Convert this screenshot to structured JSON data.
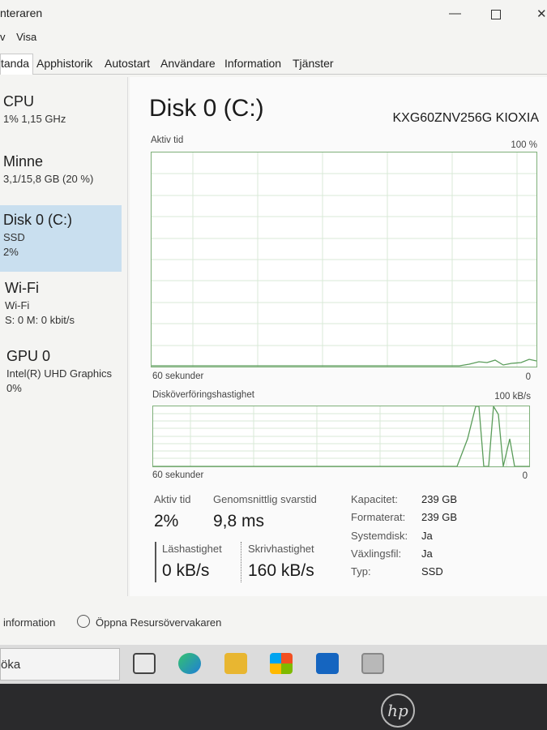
{
  "window": {
    "title": "nteraren",
    "close_glyph": "✕"
  },
  "menu": [
    "v",
    "Visa"
  ],
  "tabs": [
    {
      "label": "tanda",
      "active": true
    },
    {
      "label": "Apphistorik"
    },
    {
      "label": "Autostart"
    },
    {
      "label": "Användare"
    },
    {
      "label": "Information"
    },
    {
      "label": "Tjänster"
    }
  ],
  "sidebar": [
    {
      "name": "CPU",
      "line1": "1%  1,15 GHz",
      "line2": ""
    },
    {
      "name": "Minne",
      "line1": "3,1/15,8 GB (20 %)",
      "line2": ""
    },
    {
      "name": "Disk 0 (C:)",
      "line1": "SSD",
      "line2": "2%",
      "selected": true
    },
    {
      "name": "Wi-Fi",
      "line1": "Wi-Fi",
      "line2": "S: 0  M: 0 kbit/s"
    },
    {
      "name": "GPU 0",
      "line1": "Intel(R) UHD Graphics",
      "line2": "0%"
    }
  ],
  "main": {
    "title": "Disk 0 (C:)",
    "model": "KXG60ZNV256G KIOXIA",
    "graph1": {
      "label": "Aktiv tid",
      "max": "100 %",
      "time": "60 sekunder",
      "min": "0"
    },
    "graph2": {
      "label": "Disköverföringshastighet",
      "max": "100 kB/s",
      "time": "60 sekunder",
      "min": "0"
    },
    "stats": {
      "active_label": "Aktiv tid",
      "active_value": "2%",
      "resp_label": "Genomsnittlig svarstid",
      "resp_value": "9,8 ms",
      "read_label": "Läshastighet",
      "read_value": "0 kB/s",
      "write_label": "Skrivhastighet",
      "write_value": "160 kB/s"
    },
    "props": [
      {
        "key": "Kapacitet:",
        "value": "239 GB"
      },
      {
        "key": "Formaterat:",
        "value": "239 GB"
      },
      {
        "key": "Systemdisk:",
        "value": "Ja"
      },
      {
        "key": "Växlingsfil:",
        "value": "Ja"
      },
      {
        "key": "Typ:",
        "value": "SSD"
      }
    ]
  },
  "footer": {
    "less_info": "information",
    "open_monitor": "Öppna Resursövervakaren"
  },
  "taskbar": {
    "search": "öka"
  },
  "colors": {
    "graph_line": "#6aa86a",
    "selected_bg": "#c9dfef"
  }
}
